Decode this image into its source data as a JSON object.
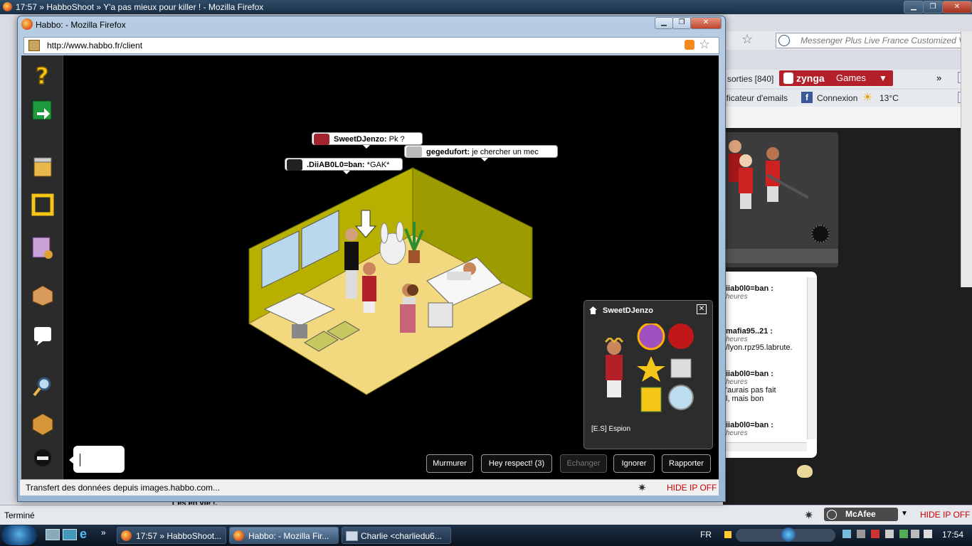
{
  "background_window": {
    "title": "17:57 » HabboShoot » Y'a pas mieux pour killer ! - Mozilla Firefox",
    "search_placeholder": "Messenger Plus Live France Customized V",
    "toolbar_sorties": "sorties [840]",
    "zynga_brand": "zynga",
    "zynga_games": "Games",
    "notifier": "ificateur d'emails",
    "connexion": "Connexion",
    "weather": "13°C",
    "status": "Terminé",
    "mcafee": "McAfee",
    "hide_ip": "HIDE IP OFF",
    "page_text": "T'es en vie !.",
    "chat_messages": [
      {
        "name": "iiab0l0=ban :",
        "time": "heures",
        "text": ""
      },
      {
        "name": "mafia95..21 :",
        "time": "heures",
        "text": "/lyon.rpz95.labrute."
      },
      {
        "name": "iiab0l0=ban :",
        "time": "heures",
        "text": "'aurais pas fait",
        "text2": "l, mais bon"
      },
      {
        "name": "iiab0l0=ban :",
        "time": "heures",
        "text": ""
      }
    ]
  },
  "popup": {
    "title": "Habbo: - Mozilla Firefox",
    "url": "http://www.habbo.fr/client",
    "status": "Transfert des données depuis images.habbo.com...",
    "hide_ip": "HIDE IP OFF"
  },
  "room": {
    "bubbles": [
      {
        "name": "SweetDJenzo:",
        "text": "Pk ?"
      },
      {
        "name": "gegedufort:",
        "text": "je chercher un mec"
      },
      {
        "name": ".DiiAB0L0=ban:",
        "text": "*GAK*"
      }
    ]
  },
  "info_panel": {
    "name": "SweetDJenzo",
    "motto": "[E.S] Espion"
  },
  "actions": {
    "whisper": "Murmurer",
    "respect": "Hey respect! (3)",
    "trade": "Echanger",
    "ignore": "Ignorer",
    "report": "Rapporter"
  },
  "taskbar": {
    "tasks": [
      "17:57 » HabboShoot...",
      "Habbo: - Mozilla Fir...",
      "Charlie <charliedu6..."
    ],
    "lang": "FR",
    "clock": "17:54"
  }
}
